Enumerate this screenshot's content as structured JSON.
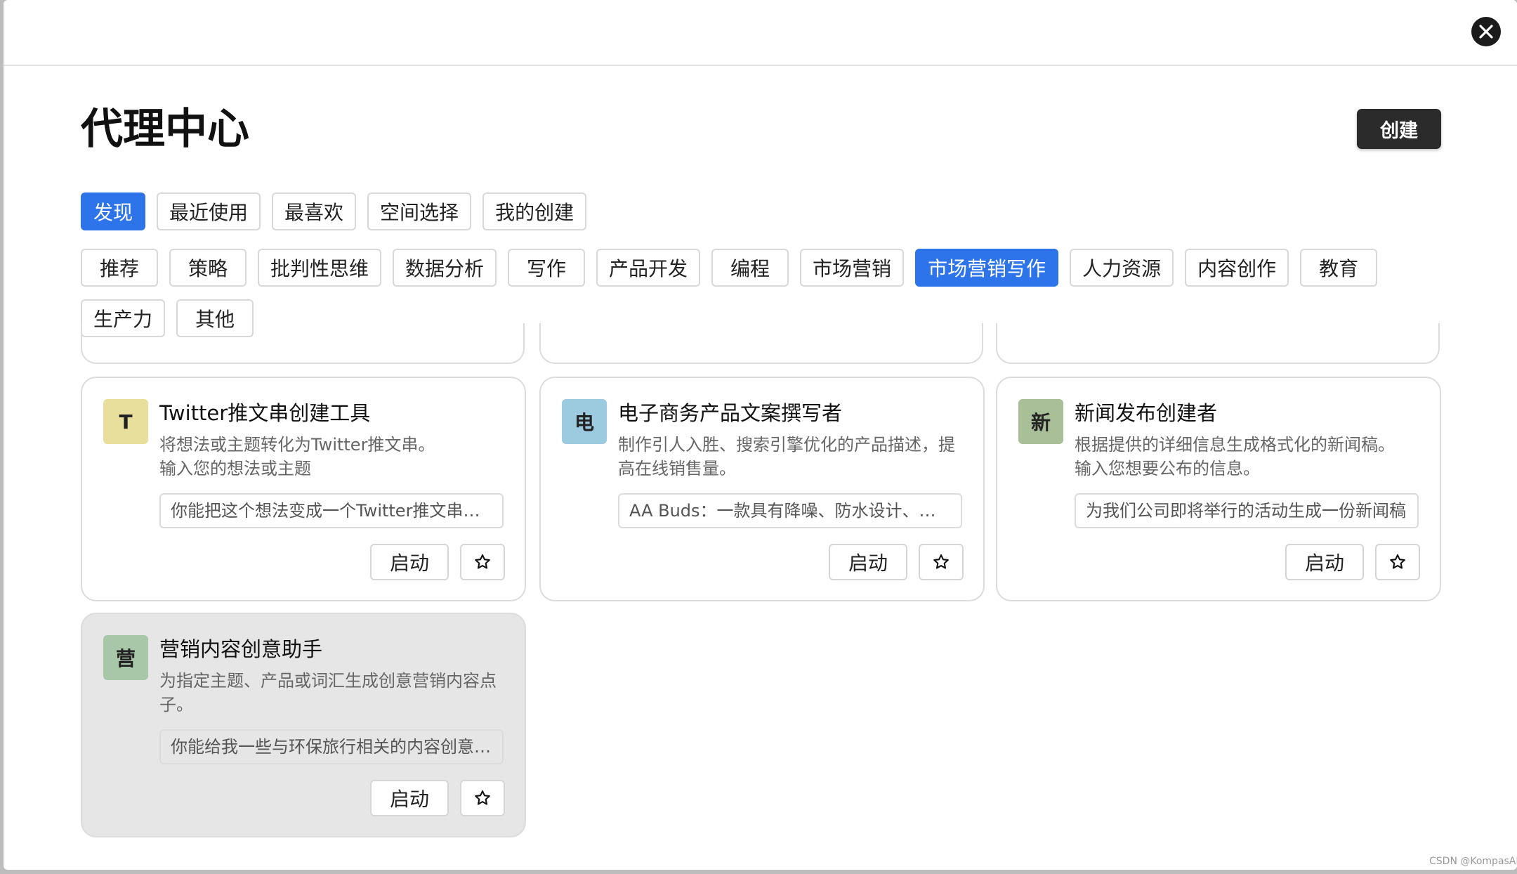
{
  "page": {
    "title": "代理中心",
    "create_label": "创建"
  },
  "tabs": [
    {
      "label": "发现",
      "active": true
    },
    {
      "label": "最近使用",
      "active": false
    },
    {
      "label": "最喜欢",
      "active": false
    },
    {
      "label": "空间选择",
      "active": false
    },
    {
      "label": "我的创建",
      "active": false
    }
  ],
  "categories": [
    {
      "label": "推荐",
      "active": false
    },
    {
      "label": "策略",
      "active": false
    },
    {
      "label": "批判性思维",
      "active": false
    },
    {
      "label": "数据分析",
      "active": false
    },
    {
      "label": "写作",
      "active": false
    },
    {
      "label": "产品开发",
      "active": false
    },
    {
      "label": "编程",
      "active": false
    },
    {
      "label": "市场营销",
      "active": false
    },
    {
      "label": "市场营销写作",
      "active": true
    },
    {
      "label": "人力资源",
      "active": false
    },
    {
      "label": "内容创作",
      "active": false
    },
    {
      "label": "教育",
      "active": false
    },
    {
      "label": "生产力",
      "active": false
    },
    {
      "label": "其他",
      "active": false
    }
  ],
  "cards": [
    {
      "avatar_letter": "T",
      "avatar_color": "#e9df9c",
      "title": "Twitter推文串创建工具",
      "desc_lines": [
        "将想法或主题转化为Twitter推文串。",
        "输入您的想法或主题"
      ],
      "prompt": "你能把这个想法变成一个Twitter推文串吗：",
      "launch_label": "启动"
    },
    {
      "avatar_letter": "电",
      "avatar_color": "#9ccadf",
      "title": "电子商务产品文案撰写者",
      "desc_lines": [
        "制作引人入胜、搜索引擎优化的产品描述，提高在线销售量。"
      ],
      "prompt": "AA Buds：一款具有降噪、防水设计、高音质的无线耳机",
      "launch_label": "启动"
    },
    {
      "avatar_letter": "新",
      "avatar_color": "#a8bf98",
      "title": "新闻发布创建者",
      "desc_lines": [
        "根据提供的详细信息生成格式化的新闻稿。",
        "输入您想要公布的信息。"
      ],
      "prompt": "为我们公司即将举行的活动生成一份新闻稿",
      "launch_label": "启动"
    },
    {
      "avatar_letter": "营",
      "avatar_color": "#a8c6a8",
      "title": "营销内容创意助手",
      "desc_lines": [
        "为指定主题、产品或词汇生成创意营销内容点子。"
      ],
      "prompt": "你能给我一些与环保旅行相关的内容创意吗？",
      "launch_label": "启动"
    }
  ],
  "watermark": "CSDN @KompasAI",
  "icons": {
    "close": "close-icon",
    "star": "star-outline-icon"
  },
  "colors": {
    "accent": "#2d74ea",
    "primary_button": "#2b2b2b"
  }
}
